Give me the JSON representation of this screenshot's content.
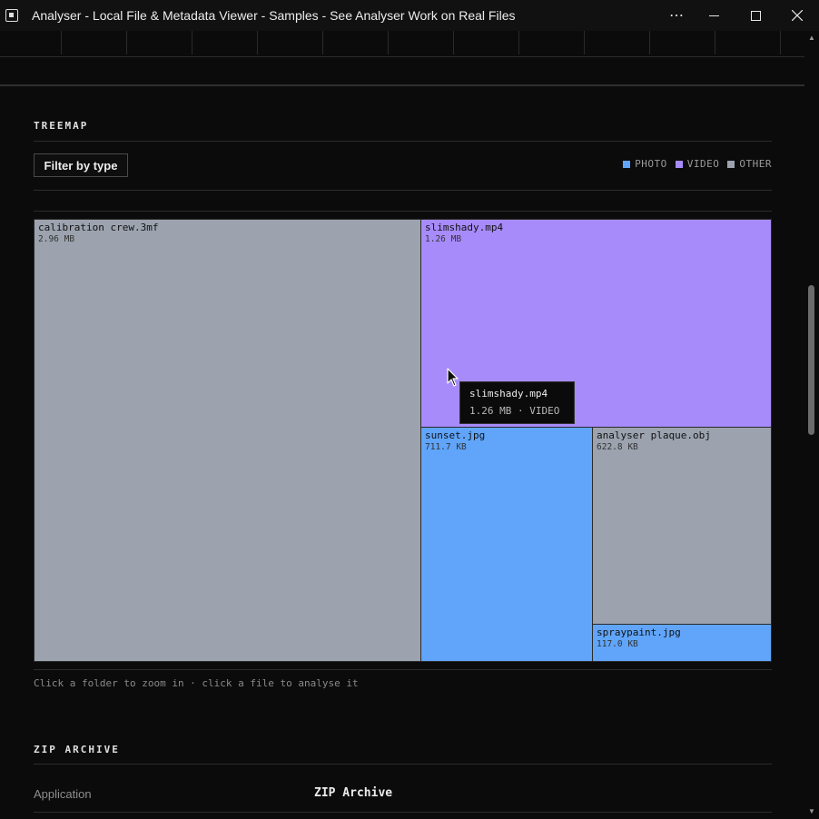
{
  "window": {
    "title": "Analyser - Local File & Metadata Viewer - Samples - See Analyser Work on Real Files",
    "controls": {
      "more": "⋯",
      "minimize": "—",
      "maximize": "☐",
      "close": "✕"
    }
  },
  "treemap_section": {
    "heading": "TREEMAP",
    "filter_button": "Filter by type",
    "legend": [
      {
        "label": "PHOTO",
        "color": "#60a5fa"
      },
      {
        "label": "VIDEO",
        "color": "#a78bfa"
      },
      {
        "label": "OTHER",
        "color": "#9ca3af"
      }
    ],
    "tiles": [
      {
        "name": "calibration crew.3mf",
        "size": "2.96 MB",
        "type": "OTHER",
        "color": "#9ca3af"
      },
      {
        "name": "slimshady.mp4",
        "size": "1.26 MB",
        "type": "VIDEO",
        "color": "#a78bfa"
      },
      {
        "name": "sunset.jpg",
        "size": "711.7 KB",
        "type": "PHOTO",
        "color": "#60a5fa"
      },
      {
        "name": "analyser plaque.obj",
        "size": "622.8 KB",
        "type": "OTHER",
        "color": "#9ca3af"
      },
      {
        "name": "spraypaint.jpg",
        "size": "117.0 KB",
        "type": "PHOTO",
        "color": "#60a5fa"
      }
    ],
    "tooltip": {
      "name": "slimshady.mp4",
      "meta": "1.26 MB · VIDEO"
    },
    "hint": "Click a folder to zoom in · click a file to analyse it"
  },
  "zip_section": {
    "heading": "ZIP ARCHIVE",
    "rows": [
      {
        "label": "Application",
        "value": "ZIP Archive"
      }
    ]
  }
}
